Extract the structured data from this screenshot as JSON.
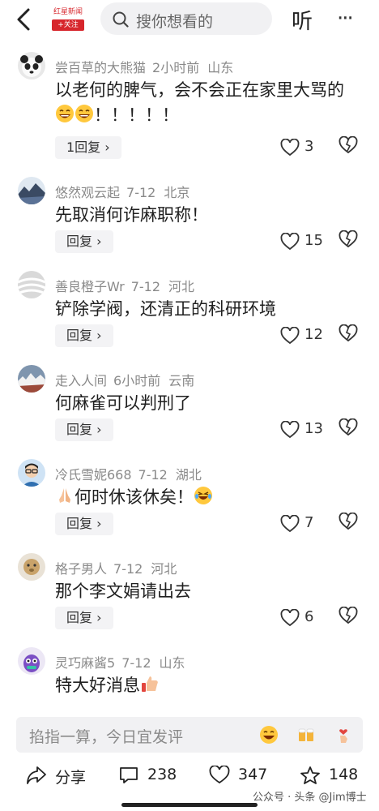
{
  "header": {
    "logo_text": "红星新闻",
    "follow_label": "+关注",
    "search_placeholder": "搜你想看的",
    "listen_label": "听",
    "more_label": "···"
  },
  "comments": [
    {
      "user": "尝百草的大熊猫",
      "time": "2小时前",
      "location": "山东",
      "text": "以老何的脾气，会不会正在家里大骂的",
      "text_suffix": "！！！！！",
      "reply_label": "1回复",
      "likes": "3"
    },
    {
      "user": "悠然观云起",
      "time": "7-12",
      "location": "北京",
      "text": "先取消何诈麻职称！",
      "reply_label": "回复",
      "likes": "15"
    },
    {
      "user": "善良橙子Wr",
      "time": "7-12",
      "location": "河北",
      "text": "铲除学阀，还清正的科研环境",
      "reply_label": "回复",
      "likes": "12"
    },
    {
      "user": "走入人间",
      "time": "6小时前",
      "location": "云南",
      "text": "何麻雀可以判刑了",
      "reply_label": "回复",
      "likes": "13"
    },
    {
      "user": "冷氏雪妮668",
      "time": "7-12",
      "location": "湖北",
      "text": "何时休该休矣！",
      "reply_label": "回复",
      "likes": "7"
    },
    {
      "user": "格子男人",
      "time": "7-12",
      "location": "河北",
      "text": "那个李文娟请出去",
      "reply_label": "回复",
      "likes": "6"
    },
    {
      "user": "灵巧麻酱5",
      "time": "7-12",
      "location": "山东",
      "text": "特大好消息",
      "reply_label": "",
      "likes": ""
    }
  ],
  "input": {
    "placeholder": "掐指一算，今日宜发评"
  },
  "bottom_bar": {
    "share_label": "分享",
    "comments_count": "238",
    "likes_count": "347",
    "favorites_count": "148"
  },
  "watermark": "公众号 · 头条 @Jim博士",
  "colors": {
    "accent_red": "#d7262c",
    "text_gray": "#8a8a8a",
    "chip_bg": "#f3f3f5"
  }
}
